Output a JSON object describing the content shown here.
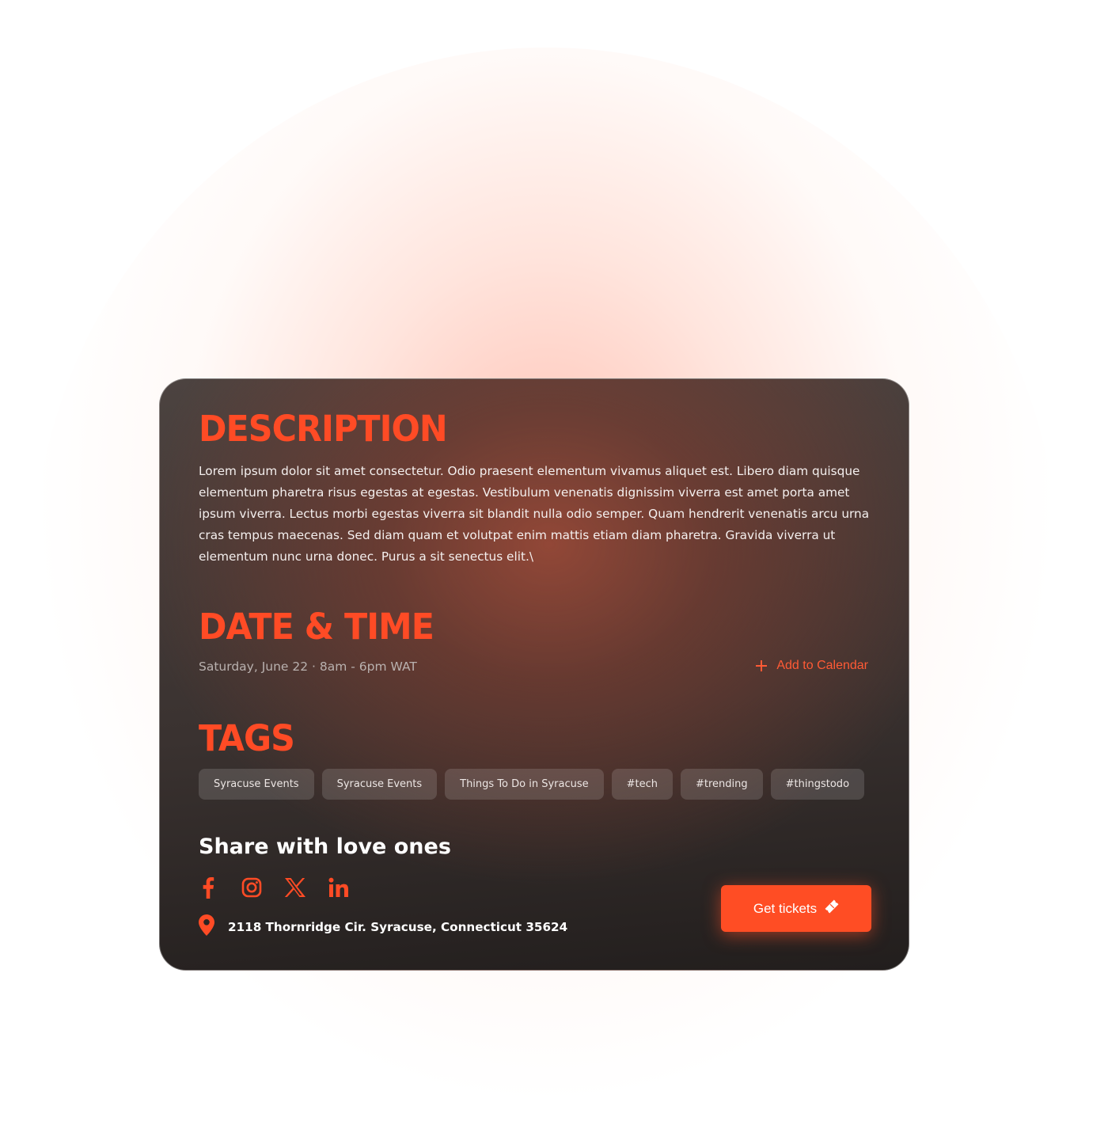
{
  "theme": {
    "accent": "#ff4b25",
    "card_top": "#4c4340",
    "card_bottom": "#221e1d",
    "text_light": "#f4efee",
    "text_muted": "#b9b1af"
  },
  "description": {
    "title": "DESCRIPTION",
    "body": "Lorem ipsum dolor sit amet consectetur. Odio praesent elementum vivamus aliquet est. Libero diam quisque elementum pharetra risus egestas at egestas. Vestibulum venenatis dignissim viverra est amet porta amet ipsum viverra. Lectus morbi egestas viverra sit blandit nulla odio semper. Quam hendrerit venenatis arcu urna cras tempus maecenas. Sed diam quam et volutpat enim mattis etiam diam pharetra. Gravida viverra ut elementum nunc urna donec. Purus a sit senectus elit.\\"
  },
  "date_time": {
    "title": "DATE & TIME",
    "value": "Saturday, June 22 · 8am - 6pm WAT",
    "add_to_calendar_label": "Add to Calendar",
    "add_icon": "plus-icon"
  },
  "tags": {
    "title": "TAGS",
    "items": [
      "Syracuse Events",
      "Syracuse Events",
      "Things To Do in Syracuse",
      "#tech",
      "#trending",
      "#thingstodo"
    ]
  },
  "share": {
    "title": "Share with love ones",
    "icons": [
      "facebook-icon",
      "instagram-icon",
      "x-icon",
      "linkedin-icon"
    ]
  },
  "location": {
    "icon": "map-pin-icon",
    "address": "2118 Thornridge Cir. Syracuse, Connecticut 35624"
  },
  "cta": {
    "label": "Get tickets",
    "icon": "ticket-icon"
  }
}
